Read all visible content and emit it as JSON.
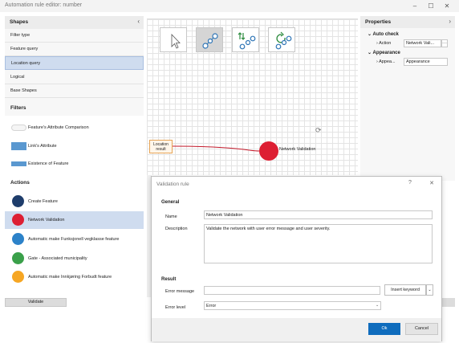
{
  "window": {
    "title": "Automation rule editor: number",
    "minimize_glyph": "–",
    "maximize_glyph": "☐",
    "close_glyph": "✕"
  },
  "shapes_panel": {
    "title": "Shapes",
    "collapse_glyph": "‹",
    "categories": [
      {
        "label": "Filter type",
        "selected": false
      },
      {
        "label": "Feature query",
        "selected": false
      },
      {
        "label": "Location query",
        "selected": true
      },
      {
        "label": "Logical",
        "selected": false
      },
      {
        "label": "Base Shapes",
        "selected": false
      }
    ],
    "filters_title": "Filters",
    "filters": [
      {
        "label": "Feature's Attribute Comparison",
        "icon": "pill-icon"
      },
      {
        "label": "Link's Attribute",
        "icon": "rect-icon"
      },
      {
        "label": "Existence of Feature",
        "icon": "rect-icon"
      }
    ],
    "actions_title": "Actions",
    "actions": [
      {
        "label": "Create Feature",
        "color": "#1e3d6b",
        "selected": false
      },
      {
        "label": "Network Validation",
        "color": "#dd1f33",
        "selected": true
      },
      {
        "label": "Automatic make Funksjonell vegklasse feature",
        "color": "#2c82c9",
        "selected": false
      },
      {
        "label": "Gate - Associated municipality",
        "color": "#3aa04a",
        "selected": false
      },
      {
        "label": "Automatic make Innkjøring Forbudt feature",
        "color": "#f6a623",
        "selected": false
      }
    ],
    "validate_label": "Validate"
  },
  "canvas": {
    "tools": [
      "pointer-tool",
      "connect-tool",
      "sort-tool",
      "refresh-tool"
    ],
    "input_node_label": "Location result",
    "node_label": "Network Validation",
    "node_color": "#dd1f33",
    "input_node_color": "#e7a455",
    "rotate_glyph": "⟳"
  },
  "properties": {
    "title": "Properties",
    "collapse_glyph": "›",
    "groups": [
      {
        "title": "Auto check",
        "row_label": "Action",
        "value": "Network Vali...",
        "has_ellipsis": true
      },
      {
        "title": "Appearance",
        "row_label": "Appea...",
        "value": "Appearance",
        "has_ellipsis": false
      }
    ],
    "ellipsis_glyph": "···"
  },
  "dialog": {
    "title": "Validation rule",
    "help_glyph": "?",
    "close_glyph": "✕",
    "general_title": "General",
    "name_label": "Name",
    "name_value": "Network Validation",
    "description_label": "Description",
    "description_value": "Validate the network with user error message and user severity.",
    "result_title": "Result",
    "error_message_label": "Error message",
    "error_message_value": "",
    "insert_keyword_label": "Insert keyword",
    "error_level_label": "Error level",
    "error_level_value": "Error",
    "ok_label": "Ok",
    "cancel_label": "Cancel",
    "accent_color": "#0f6cbd"
  }
}
